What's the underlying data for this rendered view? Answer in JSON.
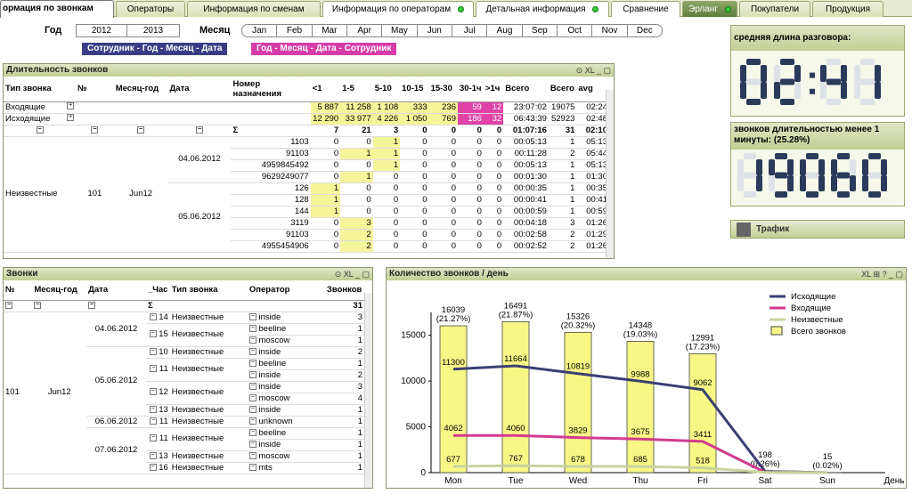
{
  "tabs": [
    "ормация по звонкам",
    "Операторы",
    "Информация по сменам",
    "Информация по операторам",
    "Детальная информация",
    "Сравнение",
    "Эрланг",
    "Покупатели",
    "Продукция"
  ],
  "filters": {
    "year_label": "Год",
    "years": [
      "2012",
      "2013"
    ],
    "month_label": "Месяц",
    "months": [
      "Jan",
      "Feb",
      "Mar",
      "Apr",
      "May",
      "Jun",
      "Jul",
      "Aug",
      "Sep",
      "Oct",
      "Nov",
      "Dec"
    ],
    "pill1": "Сотрудник - Год - Месяц - Дата",
    "pill2": "Год - Месяц - Дата - Сотрудник"
  },
  "duration": {
    "title": "Длительность звонков",
    "ctrl": "XL",
    "headers": [
      "Тип звонка",
      "№",
      "Месяц-год",
      "Дата",
      "Номер назначения",
      "<1",
      "1-5",
      "5-10",
      "10-15",
      "15-30",
      "30-1ч",
      ">1ч",
      "Всего",
      "Всего",
      "avg"
    ],
    "type_rows": [
      {
        "label": "Входящие",
        "vals": [
          "5 887",
          "11 258",
          "1 108",
          "333",
          "236",
          "59",
          "12",
          "23:07:02",
          "19075",
          "02:24"
        ]
      },
      {
        "label": "Исходящие",
        "vals": [
          "12 290",
          "33 977",
          "4 226",
          "1 050",
          "769",
          "186",
          "32",
          "06:43:39",
          "52923",
          "02:48"
        ]
      }
    ],
    "sum_row": {
      "sym": "Σ",
      "vals": [
        "7",
        "21",
        "3",
        "0",
        "0",
        "0",
        "0",
        "01:07:16",
        "31",
        "02:10"
      ]
    },
    "group": {
      "type": "Неизвестные",
      "num": "101",
      "month": "Jun12"
    },
    "dates": [
      "04.06.2012",
      "05.06.2012"
    ],
    "rows": [
      [
        "1103",
        "0",
        "0",
        "1",
        "0",
        "0",
        "0",
        "0",
        "00:05:13",
        "1",
        "05:13"
      ],
      [
        "91103",
        "0",
        "1",
        "1",
        "0",
        "0",
        "0",
        "0",
        "00:11:28",
        "2",
        "05:44"
      ],
      [
        "4959845492",
        "0",
        "0",
        "1",
        "0",
        "0",
        "0",
        "0",
        "00:05:13",
        "1",
        "05:13"
      ],
      [
        "9629249077",
        "0",
        "1",
        "0",
        "0",
        "0",
        "0",
        "0",
        "00:01:30",
        "1",
        "01:30"
      ],
      [
        "126",
        "1",
        "0",
        "0",
        "0",
        "0",
        "0",
        "0",
        "00:00:35",
        "1",
        "00:35"
      ],
      [
        "128",
        "1",
        "0",
        "0",
        "0",
        "0",
        "0",
        "0",
        "00:00:41",
        "1",
        "00:41"
      ],
      [
        "144",
        "1",
        "0",
        "0",
        "0",
        "0",
        "0",
        "0",
        "00:00:59",
        "1",
        "00:59"
      ],
      [
        "3119",
        "0",
        "3",
        "0",
        "0",
        "0",
        "0",
        "0",
        "00:04:18",
        "3",
        "01:26"
      ],
      [
        "91103",
        "0",
        "2",
        "0",
        "0",
        "0",
        "0",
        "0",
        "00:02:58",
        "2",
        "01:29"
      ],
      [
        "4955454906",
        "0",
        "2",
        "0",
        "0",
        "0",
        "0",
        "0",
        "00:02:52",
        "2",
        "01:26"
      ]
    ]
  },
  "kpi": {
    "avg_title": "средняя длина разговора:",
    "avg_value": "02:41",
    "short_title": "звонков длительностью менее 1 минуты: (25.28%)",
    "short_value": "19060",
    "traffic": "Трафик"
  },
  "calls": {
    "title": "Звонки",
    "ctrl": "XL",
    "headers": [
      "№",
      "Месяц-год",
      "Дата",
      "_Час",
      "Тип звонка",
      "Оператор",
      "Звонков"
    ],
    "sum_sym": "Σ",
    "sum_val": "31",
    "group": {
      "num": "101",
      "month": "Jun12"
    },
    "rows": [
      {
        "date": "04.06.2012",
        "hour": "14",
        "type": "Неизвестные",
        "op": "inside",
        "n": "3"
      },
      {
        "date": "",
        "hour": "15",
        "type": "Неизвестные",
        "op": "beeline",
        "n": "1"
      },
      {
        "date": "",
        "hour": "",
        "type": "",
        "op": "moscow",
        "n": "1"
      },
      {
        "date": "05.06.2012",
        "hour": "10",
        "type": "Неизвестные",
        "op": "inside",
        "n": "2"
      },
      {
        "date": "",
        "hour": "11",
        "type": "Неизвестные",
        "op": "beeline",
        "n": "1"
      },
      {
        "date": "",
        "hour": "",
        "type": "",
        "op": "inside",
        "n": "2"
      },
      {
        "date": "",
        "hour": "12",
        "type": "Неизвестные",
        "op": "inside",
        "n": "3"
      },
      {
        "date": "",
        "hour": "",
        "type": "",
        "op": "moscow",
        "n": "4"
      },
      {
        "date": "",
        "hour": "13",
        "type": "Неизвестные",
        "op": "inside",
        "n": "1"
      },
      {
        "date": "06.06.2012",
        "hour": "11",
        "type": "Неизвестные",
        "op": "unknown",
        "n": "1"
      },
      {
        "date": "07.06.2012",
        "hour": "11",
        "type": "Неизвестные",
        "op": "beeline",
        "n": "1"
      },
      {
        "date": "",
        "hour": "",
        "type": "",
        "op": "inside",
        "n": "1"
      },
      {
        "date": "",
        "hour": "13",
        "type": "Неизвестные",
        "op": "moscow",
        "n": "1"
      },
      {
        "date": "",
        "hour": "16",
        "type": "Неизвестные",
        "op": "mts",
        "n": "1"
      }
    ]
  },
  "chart_data": {
    "type": "bar",
    "title": "Количество звонков / день",
    "ctrl": "XL",
    "xlabel": "День",
    "categories": [
      "Mon",
      "Tue",
      "Wed",
      "Thu",
      "Fri",
      "Sat",
      "Sun"
    ],
    "ylim": [
      0,
      17500
    ],
    "yticks": [
      0,
      5000,
      10000,
      15000
    ],
    "bar_series": {
      "name": "Всего звонков",
      "values": [
        16039,
        16491,
        15326,
        14348,
        12991,
        198,
        15
      ],
      "labels": [
        "(21.27%)",
        "(21.87%)",
        "(20.32%)",
        "(19.03%)",
        "(17.23%)",
        "(0.26%)",
        "(0.02%)"
      ]
    },
    "series": [
      {
        "name": "Исходящие",
        "color": "#3a3f72",
        "values": [
          11300,
          11664,
          10819,
          9988,
          9062,
          null,
          null
        ]
      },
      {
        "name": "Входящие",
        "color": "#d23a8e",
        "values": [
          4062,
          4060,
          3829,
          3675,
          3411,
          null,
          null
        ]
      },
      {
        "name": "Неизвестные",
        "color": "#c9d39f",
        "values": [
          677,
          767,
          678,
          685,
          518,
          null,
          null
        ]
      }
    ],
    "line_tail": [
      198,
      15
    ]
  }
}
